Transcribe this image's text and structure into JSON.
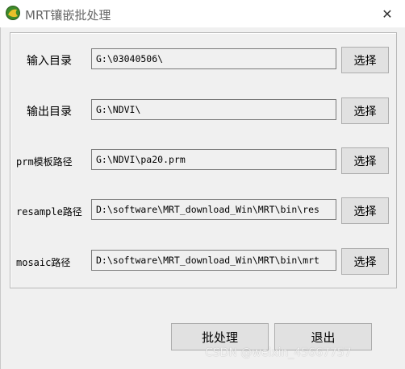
{
  "window": {
    "title": "MRT镶嵌批处理",
    "close_glyph": "✕",
    "app_icon": "mrt-app-icon"
  },
  "rows": [
    {
      "label": "输入目录",
      "value": "G:\\03040506\\",
      "button": "选择"
    },
    {
      "label": "输出目录",
      "value": "G:\\NDVI\\",
      "button": "选择"
    },
    {
      "label": "prm模板路径",
      "value": "G:\\NDVI\\pa20.prm",
      "button": "选择"
    },
    {
      "label": "resample路径",
      "value": "D:\\software\\MRT_download_Win\\MRT\\bin\\res",
      "button": "选择"
    },
    {
      "label": "mosaic路径",
      "value": "D:\\software\\MRT_download_Win\\MRT\\bin\\mrt",
      "button": "选择"
    }
  ],
  "actions": {
    "batch_label": "批处理",
    "exit_label": "退出"
  },
  "watermark": "CSDN @weixin_45667757",
  "colors": {
    "background": "#f0f0f0",
    "button_face": "#e1e1e1",
    "border": "#adadad"
  }
}
